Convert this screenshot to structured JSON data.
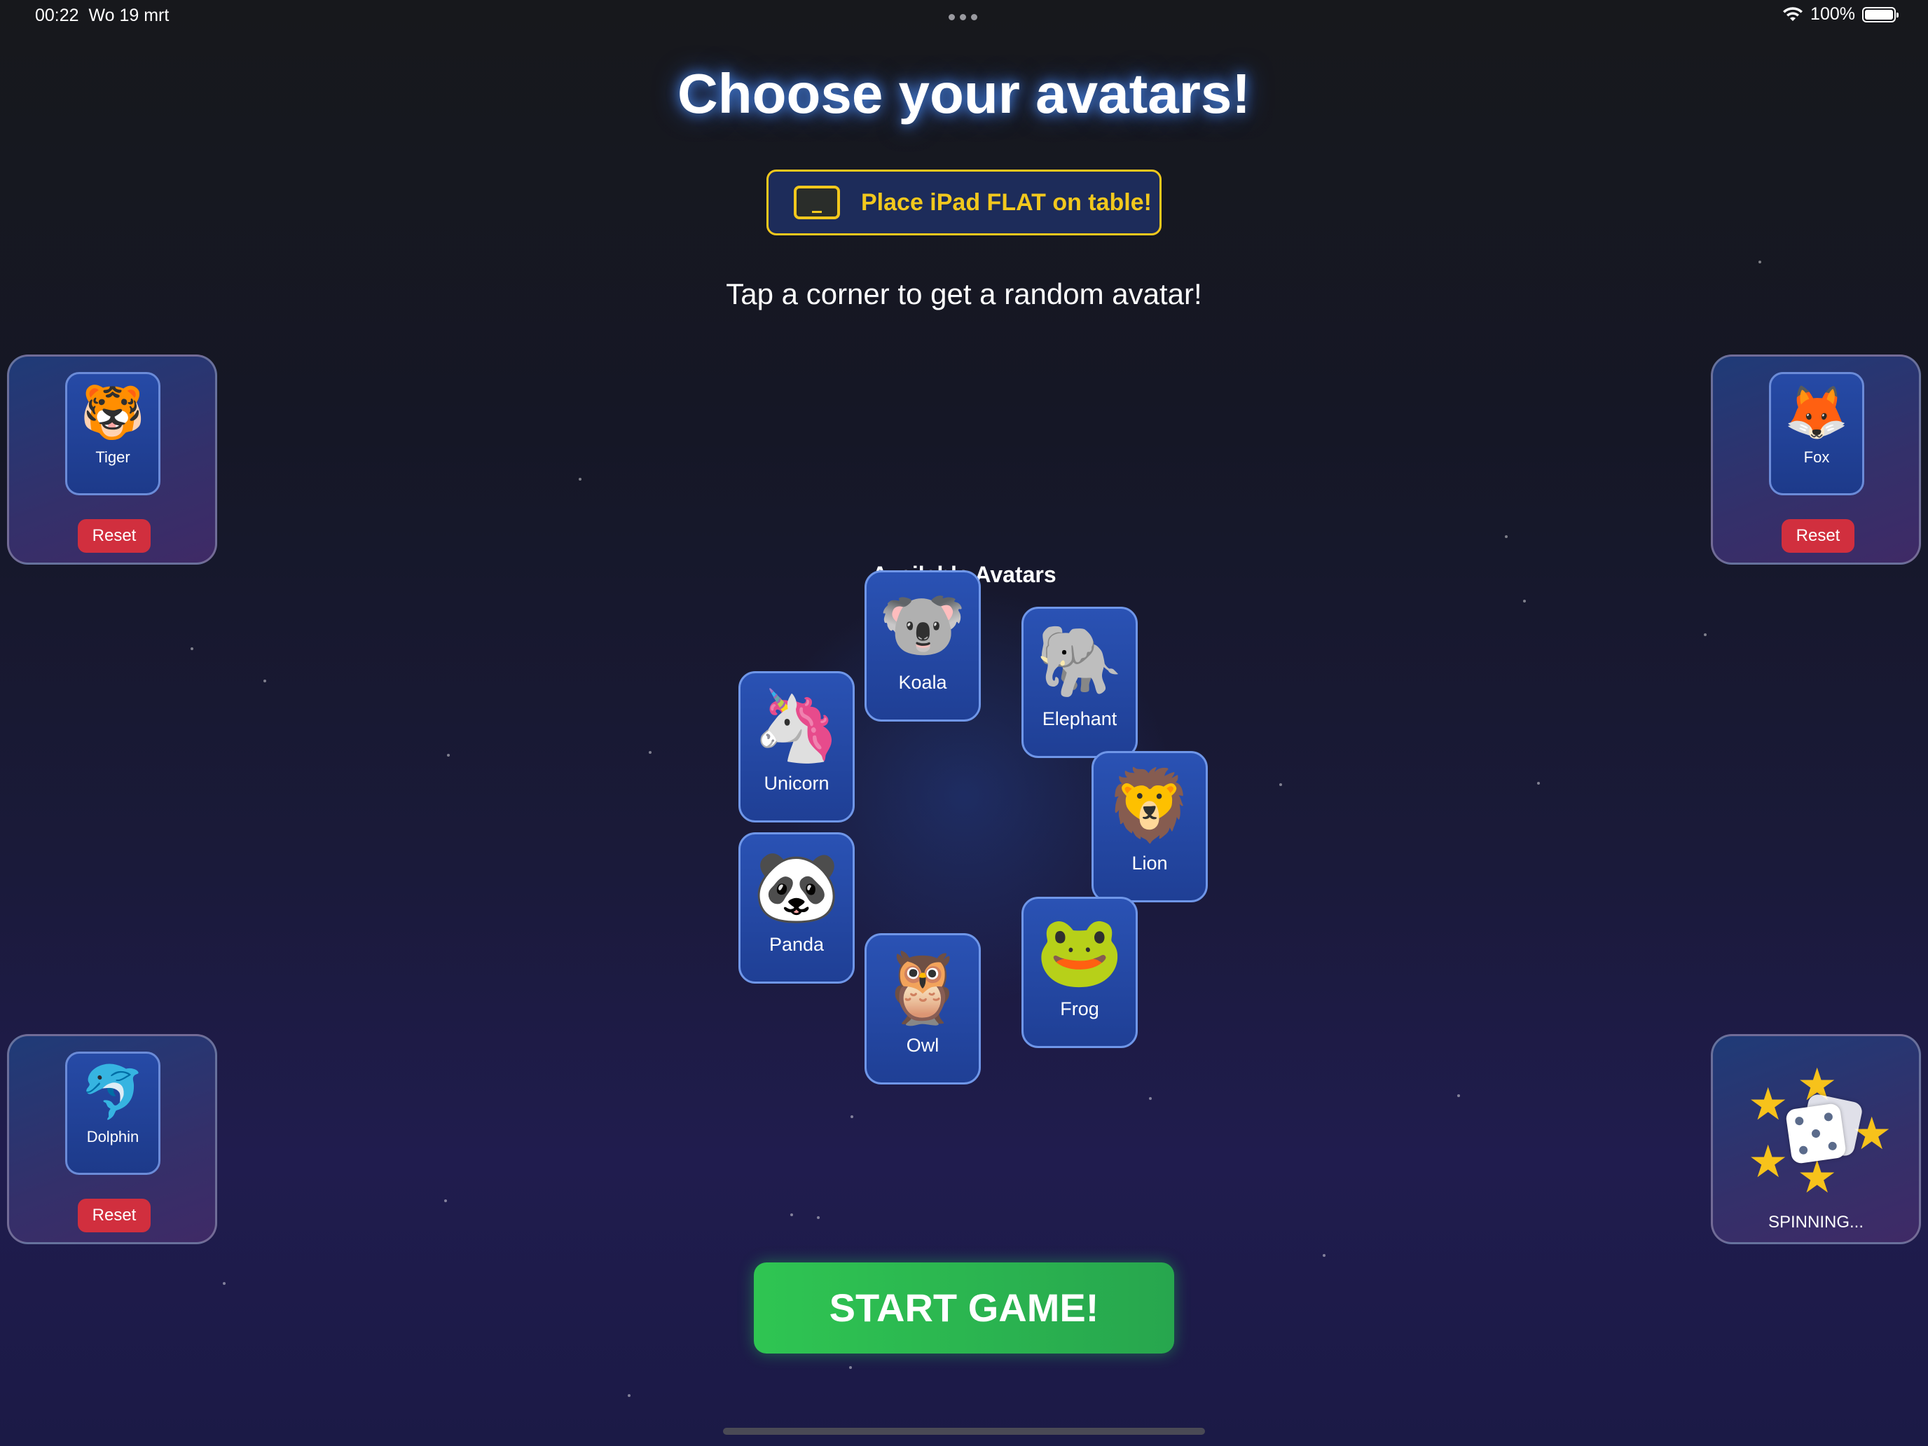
{
  "status_bar": {
    "time": "00:22",
    "date": "Wo 19 mrt",
    "battery": "100%"
  },
  "header": {
    "title": "Choose your avatars!",
    "banner": "Place iPad FLAT on table!",
    "subtitle": "Tap a corner to get a random avatar!"
  },
  "corners": {
    "top_left": {
      "emoji": "🐯",
      "name": "Tiger",
      "reset": "Reset"
    },
    "top_right": {
      "emoji": "🦊",
      "name": "Fox",
      "reset": "Reset"
    },
    "bottom_left": {
      "emoji": "🐬",
      "name": "Dolphin",
      "reset": "Reset"
    },
    "bottom_right": {
      "status": "SPINNING..."
    }
  },
  "available": {
    "title": "Available Avatars",
    "avatars": [
      {
        "emoji": "🐨",
        "name": "Koala"
      },
      {
        "emoji": "🐘",
        "name": "Elephant"
      },
      {
        "emoji": "🦁",
        "name": "Lion"
      },
      {
        "emoji": "🐸",
        "name": "Frog"
      },
      {
        "emoji": "🦉",
        "name": "Owl"
      },
      {
        "emoji": "🐼",
        "name": "Panda"
      },
      {
        "emoji": "🦄",
        "name": "Unicorn"
      }
    ]
  },
  "start_button": "START GAME!",
  "colors": {
    "accent_yellow": "#f2c81d",
    "start_green": "#2fc552",
    "reset_red": "#d12f3e",
    "card_blue": "#2a52b4"
  }
}
